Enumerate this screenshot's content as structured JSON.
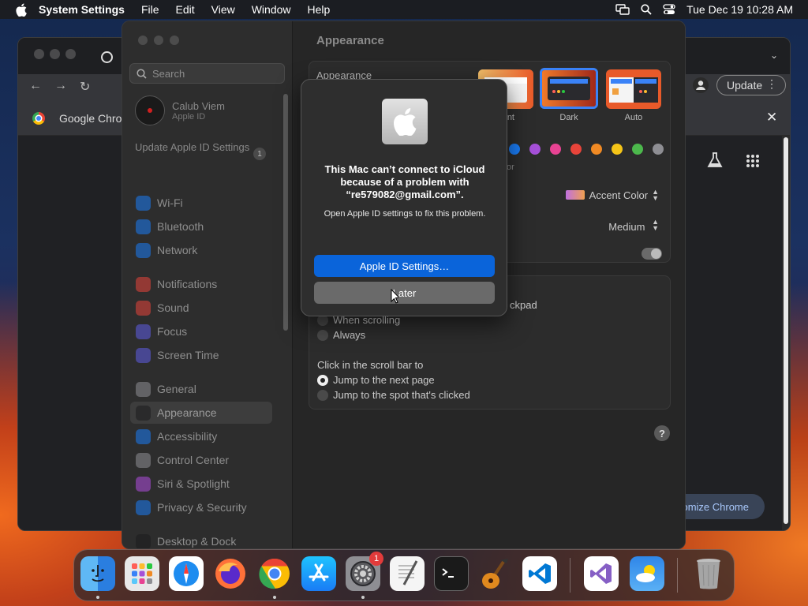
{
  "menubar": {
    "app_name": "System Settings",
    "menus": [
      "File",
      "Edit",
      "View",
      "Window",
      "Help"
    ],
    "clock": "Tue Dec 19  10:28 AM"
  },
  "chrome": {
    "bookmark_title": "Google Chrome",
    "update_label": "Update",
    "customize_label": "Customize Chrome"
  },
  "settings": {
    "search_placeholder": "Search",
    "user_name": "Calub Viem",
    "user_sub": "Apple ID",
    "update_apple_id": "Update Apple ID Settings",
    "update_badge": "1",
    "sidebar_items": [
      {
        "label": "Wi-Fi",
        "color": "#1a7cf5"
      },
      {
        "label": "Bluetooth",
        "color": "#1a7cf5"
      },
      {
        "label": "Network",
        "color": "#1a7cf5"
      },
      {
        "label": "Notifications",
        "color": "#e8443a"
      },
      {
        "label": "Sound",
        "color": "#e8443a"
      },
      {
        "label": "Focus",
        "color": "#5e5ce6"
      },
      {
        "label": "Screen Time",
        "color": "#5e5ce6"
      },
      {
        "label": "General",
        "color": "#8e8e93"
      },
      {
        "label": "Appearance",
        "color": "#1c1c1e"
      },
      {
        "label": "Accessibility",
        "color": "#1a7cf5"
      },
      {
        "label": "Control Center",
        "color": "#8e8e93"
      },
      {
        "label": "Siri & Spotlight",
        "color": "#b04de0"
      },
      {
        "label": "Privacy & Security",
        "color": "#1a7cf5"
      },
      {
        "label": "Desktop & Dock",
        "color": "#1c1c1e"
      }
    ],
    "main_title": "Appearance",
    "appearance_label": "Appearance",
    "appearance_options": [
      "Light",
      "Dark",
      "Auto"
    ],
    "appearance_caption_light_partial": "nt",
    "accent_color_label": "Accent Color",
    "accent_partial": "or",
    "swatch_colors": [
      "#1a7cf5",
      "#a550d8",
      "#e84393",
      "#e8443a",
      "#f08a24",
      "#f5c518",
      "#4cb84c",
      "#8e8e93"
    ],
    "sidebar_icon_label": "Medium",
    "trackpad_partial": "ckpad",
    "scroll_options": [
      "When scrolling",
      "Always"
    ],
    "click_label": "Click in the scroll bar to",
    "click_options": [
      "Jump to the next page",
      "Jump to the spot that's clicked"
    ]
  },
  "dialog": {
    "title": "This Mac can’t connect to iCloud because of a problem with “re579082@gmail.com”.",
    "message": "Open Apple ID settings to fix this problem.",
    "primary_button": "Apple ID Settings…",
    "secondary_button": "Later"
  },
  "dock": {
    "settings_badge": "1",
    "apps": [
      "Finder",
      "Launchpad",
      "Safari",
      "Firefox",
      "Google Chrome",
      "App Store",
      "System Settings",
      "TextEdit",
      "Terminal",
      "GarageBand",
      "Visual Studio Code",
      "Visual Studio",
      "Weather",
      "Trash"
    ]
  }
}
